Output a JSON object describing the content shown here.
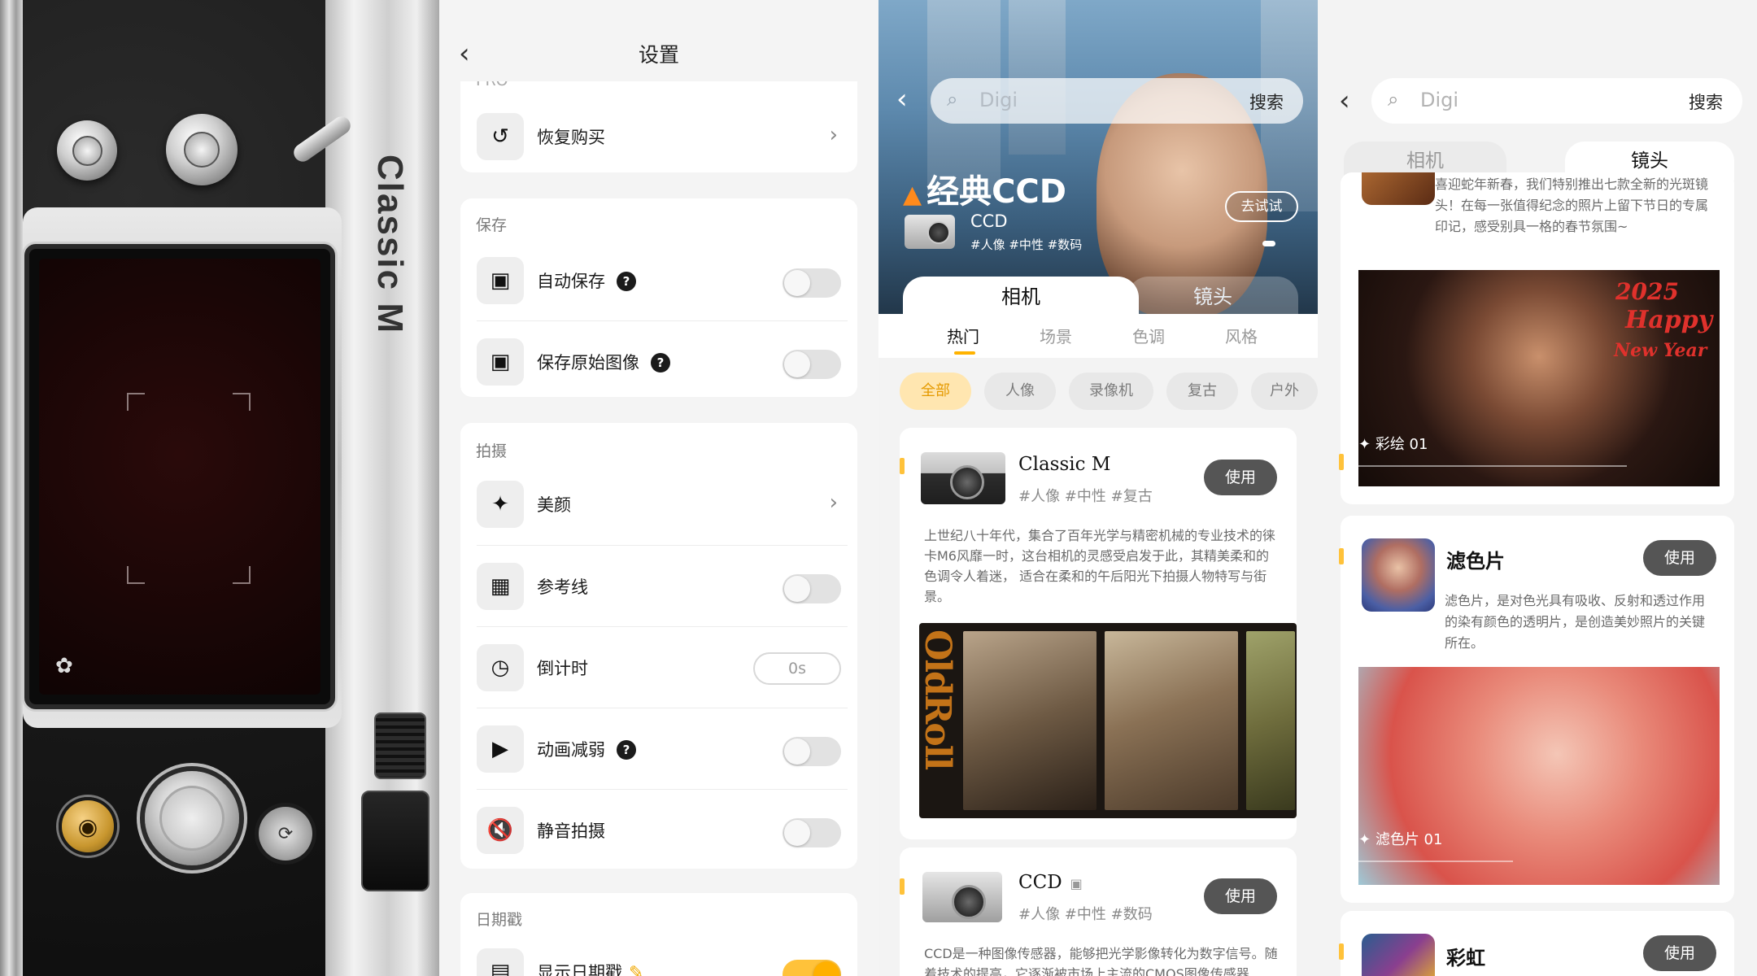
{
  "camera_panel": {
    "brand_text": "Classic M",
    "icons": {
      "left_knob": "exposure-knob-icon",
      "gold_button": "camera-icon",
      "flip_button": "flip-camera-icon",
      "screen_icon": "ghost-mode-icon"
    },
    "shutter_text": "shutter"
  },
  "settings": {
    "title": "设置",
    "back_glyph": "‹",
    "partial_section": "PRO",
    "restore_label": "恢复购买",
    "sections": {
      "save": "保存",
      "shoot": "拍摄",
      "date": "日期戳"
    },
    "rows": {
      "auto_save": "自动保存",
      "save_original": "保存原始图像",
      "beauty": "美颜",
      "grid": "参考线",
      "timer": "倒计时",
      "timer_value": "0s",
      "reduce_motion": "动画减弱",
      "silent": "静音拍摄",
      "show_date": "显示日期戳"
    },
    "toggles": {
      "auto_save": false,
      "save_original": false,
      "grid": false,
      "reduce_motion": false,
      "silent": false,
      "show_date": true
    },
    "help_glyph": "?",
    "chevron_glyph": "›"
  },
  "store": {
    "search_placeholder": "Digi",
    "search_button": "搜索",
    "hero_title": "经典CCD",
    "hero_sub": "CCD",
    "hero_tags": "#人像 #中性 #数码",
    "try_button": "去试试",
    "tabs": [
      "相机",
      "镜头"
    ],
    "subtabs": [
      "热门",
      "场景",
      "色调",
      "风格"
    ],
    "chips": [
      "全部",
      "人像",
      "录像机",
      "复古",
      "户外"
    ],
    "items": [
      {
        "name": "Classic M",
        "tags": "#人像  #中性  #复古",
        "use": "使用",
        "desc": "上世纪八十年代，集合了百年光学与精密机械的专业技术的徕卡M6风靡一时，这台相机的灵感受启发于此，其精美柔和的色调令人着迷， 适合在柔和的午后阳光下拍摄人物特写与街景。",
        "film_text": "OldRoll"
      },
      {
        "name": "CCD",
        "tags": "#人像  #中性  #数码",
        "use": "使用",
        "desc": "CCD是一种图像传感器，能够把光学影像转化为数字信号。随着技术的提高，它逐渐被市场上主流的CMOS图像传感器"
      }
    ],
    "accent_color": "#ffb300"
  },
  "lens": {
    "search_placeholder": "Digi",
    "search_button": "搜索",
    "tabs": [
      "相机",
      "镜头"
    ],
    "cards": [
      {
        "desc": "喜迎蛇年新春，我们特别推出七款全新的光斑镜头！在每一张值得纪念的照片上留下节日的专属印记，感受别具一格的春节氛围~",
        "caption": "彩绘 01",
        "overlay_2025": "2025",
        "overlay_happy": "Happy",
        "overlay_ny": "New Year"
      },
      {
        "name": "滤色片",
        "use": "使用",
        "desc": "滤色片，是对色光具有吸收、反射和透过作用的染有颜色的透明片，是创造美妙照片的关键所在。",
        "caption": "滤色片 01"
      },
      {
        "name": "彩虹",
        "use": "使用"
      }
    ],
    "sparkle_glyph": "✦"
  }
}
